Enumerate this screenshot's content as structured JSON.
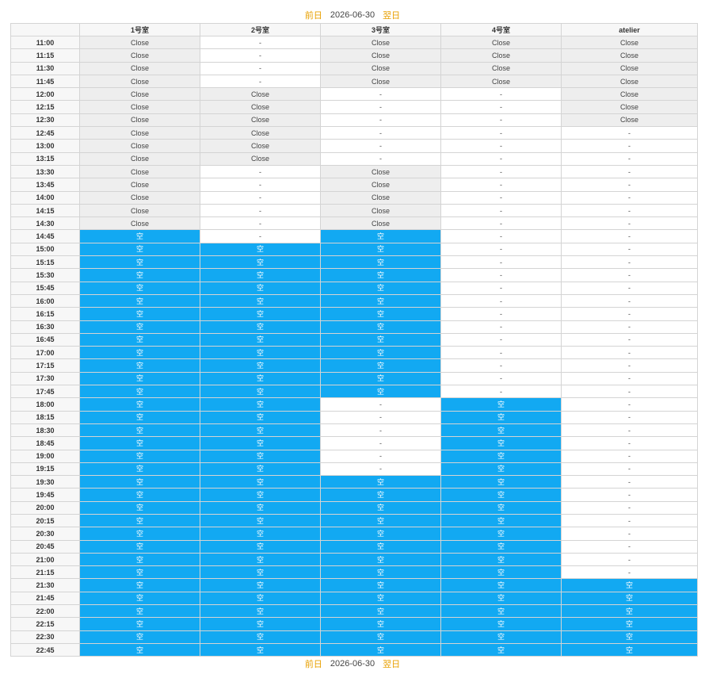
{
  "nav": {
    "prev": "前日",
    "date": "2026-06-30",
    "next": "翌日"
  },
  "columns": [
    "",
    "1号室",
    "2号室",
    "3号室",
    "4号室",
    "atelier"
  ],
  "legend": {
    "close": "Close",
    "none": "-",
    "free": "空"
  },
  "times": [
    "11:00",
    "11:15",
    "11:30",
    "11:45",
    "12:00",
    "12:15",
    "12:30",
    "12:45",
    "13:00",
    "13:15",
    "13:30",
    "13:45",
    "14:00",
    "14:15",
    "14:30",
    "14:45",
    "15:00",
    "15:15",
    "15:30",
    "15:45",
    "16:00",
    "16:15",
    "16:30",
    "16:45",
    "17:00",
    "17:15",
    "17:30",
    "17:45",
    "18:00",
    "18:15",
    "18:30",
    "18:45",
    "19:00",
    "19:15",
    "19:30",
    "19:45",
    "20:00",
    "20:15",
    "20:30",
    "20:45",
    "21:00",
    "21:15",
    "21:30",
    "21:45",
    "22:00",
    "22:15",
    "22:30",
    "22:45"
  ],
  "cells": [
    [
      "Close",
      "-",
      "Close",
      "Close",
      "Close"
    ],
    [
      "Close",
      "-",
      "Close",
      "Close",
      "Close"
    ],
    [
      "Close",
      "-",
      "Close",
      "Close",
      "Close"
    ],
    [
      "Close",
      "-",
      "Close",
      "Close",
      "Close"
    ],
    [
      "Close",
      "Close",
      "-",
      "-",
      "Close"
    ],
    [
      "Close",
      "Close",
      "-",
      "-",
      "Close"
    ],
    [
      "Close",
      "Close",
      "-",
      "-",
      "Close"
    ],
    [
      "Close",
      "Close",
      "-",
      "-",
      "-"
    ],
    [
      "Close",
      "Close",
      "-",
      "-",
      "-"
    ],
    [
      "Close",
      "Close",
      "-",
      "-",
      "-"
    ],
    [
      "Close",
      "-",
      "Close",
      "-",
      "-"
    ],
    [
      "Close",
      "-",
      "Close",
      "-",
      "-"
    ],
    [
      "Close",
      "-",
      "Close",
      "-",
      "-"
    ],
    [
      "Close",
      "-",
      "Close",
      "-",
      "-"
    ],
    [
      "Close",
      "-",
      "Close",
      "-",
      "-"
    ],
    [
      "空",
      "-",
      "空",
      "-",
      "-"
    ],
    [
      "空",
      "空",
      "空",
      "-",
      "-"
    ],
    [
      "空",
      "空",
      "空",
      "-",
      "-"
    ],
    [
      "空",
      "空",
      "空",
      "-",
      "-"
    ],
    [
      "空",
      "空",
      "空",
      "-",
      "-"
    ],
    [
      "空",
      "空",
      "空",
      "-",
      "-"
    ],
    [
      "空",
      "空",
      "空",
      "-",
      "-"
    ],
    [
      "空",
      "空",
      "空",
      "-",
      "-"
    ],
    [
      "空",
      "空",
      "空",
      "-",
      "-"
    ],
    [
      "空",
      "空",
      "空",
      "-",
      "-"
    ],
    [
      "空",
      "空",
      "空",
      "-",
      "-"
    ],
    [
      "空",
      "空",
      "空",
      "-",
      "-"
    ],
    [
      "空",
      "空",
      "空",
      "-",
      "-"
    ],
    [
      "空",
      "空",
      "-",
      "空",
      "-"
    ],
    [
      "空",
      "空",
      "-",
      "空",
      "-"
    ],
    [
      "空",
      "空",
      "-",
      "空",
      "-"
    ],
    [
      "空",
      "空",
      "-",
      "空",
      "-"
    ],
    [
      "空",
      "空",
      "-",
      "空",
      "-"
    ],
    [
      "空",
      "空",
      "-",
      "空",
      "-"
    ],
    [
      "空",
      "空",
      "空",
      "空",
      "-"
    ],
    [
      "空",
      "空",
      "空",
      "空",
      "-"
    ],
    [
      "空",
      "空",
      "空",
      "空",
      "-"
    ],
    [
      "空",
      "空",
      "空",
      "空",
      "-"
    ],
    [
      "空",
      "空",
      "空",
      "空",
      "-"
    ],
    [
      "空",
      "空",
      "空",
      "空",
      "-"
    ],
    [
      "空",
      "空",
      "空",
      "空",
      "-"
    ],
    [
      "空",
      "空",
      "空",
      "空",
      "-"
    ],
    [
      "空",
      "空",
      "空",
      "空",
      "空"
    ],
    [
      "空",
      "空",
      "空",
      "空",
      "空"
    ],
    [
      "空",
      "空",
      "空",
      "空",
      "空"
    ],
    [
      "空",
      "空",
      "空",
      "空",
      "空"
    ],
    [
      "空",
      "空",
      "空",
      "空",
      "空"
    ],
    [
      "空",
      "空",
      "空",
      "空",
      "空"
    ]
  ],
  "colors": {
    "free": "#12a9f2",
    "close": "#eeeeee",
    "link": "#e8a000"
  }
}
